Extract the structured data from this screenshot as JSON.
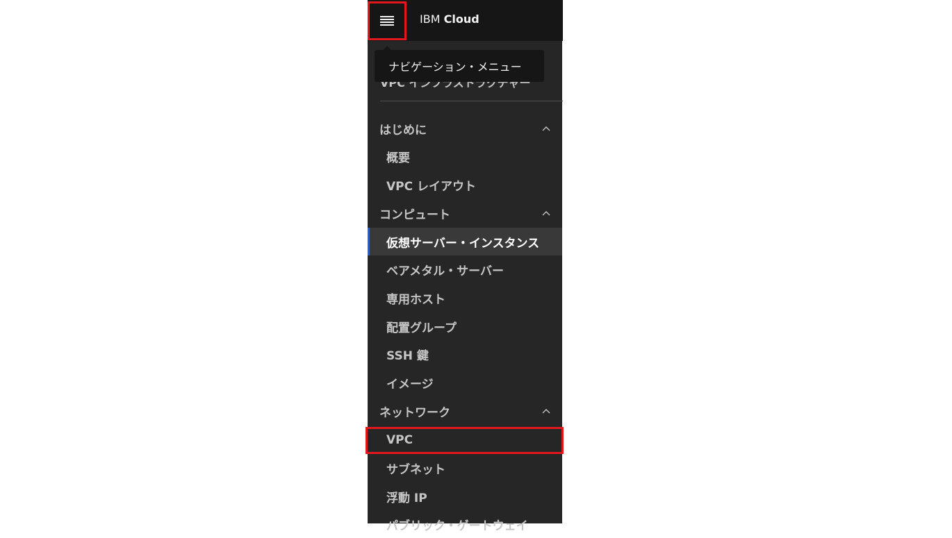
{
  "header": {
    "brand_prefix": "IBM",
    "brand_name": "Cloud",
    "menu_icon": "hamburger-menu-icon"
  },
  "tooltip": {
    "text": "ナビゲーション・メニュー"
  },
  "sidebar": {
    "title": "VPC インフラストラクチャー",
    "sections": [
      {
        "label": "はじめに",
        "expanded": true,
        "items": [
          {
            "label": "概要"
          },
          {
            "label": "VPC レイアウト"
          }
        ]
      },
      {
        "label": "コンピュート",
        "expanded": true,
        "items": [
          {
            "label": "仮想サーバー・インスタンス",
            "active": true
          },
          {
            "label": "ベアメタル・サーバー"
          },
          {
            "label": "専用ホスト"
          },
          {
            "label": "配置グループ"
          },
          {
            "label": "SSH 鍵"
          },
          {
            "label": "イメージ"
          }
        ]
      },
      {
        "label": "ネットワーク",
        "expanded": true,
        "items": [
          {
            "label": "VPC",
            "highlighted": true
          },
          {
            "label": "サブネット"
          },
          {
            "label": "浮動 IP"
          },
          {
            "label": "パブリック・ゲートウェイ"
          }
        ]
      }
    ]
  },
  "colors": {
    "panel_bg": "#262626",
    "topbar_bg": "#161616",
    "active_bg": "#393939",
    "active_indicator": "#0f62fe",
    "annotation_red": "#e3181f"
  }
}
